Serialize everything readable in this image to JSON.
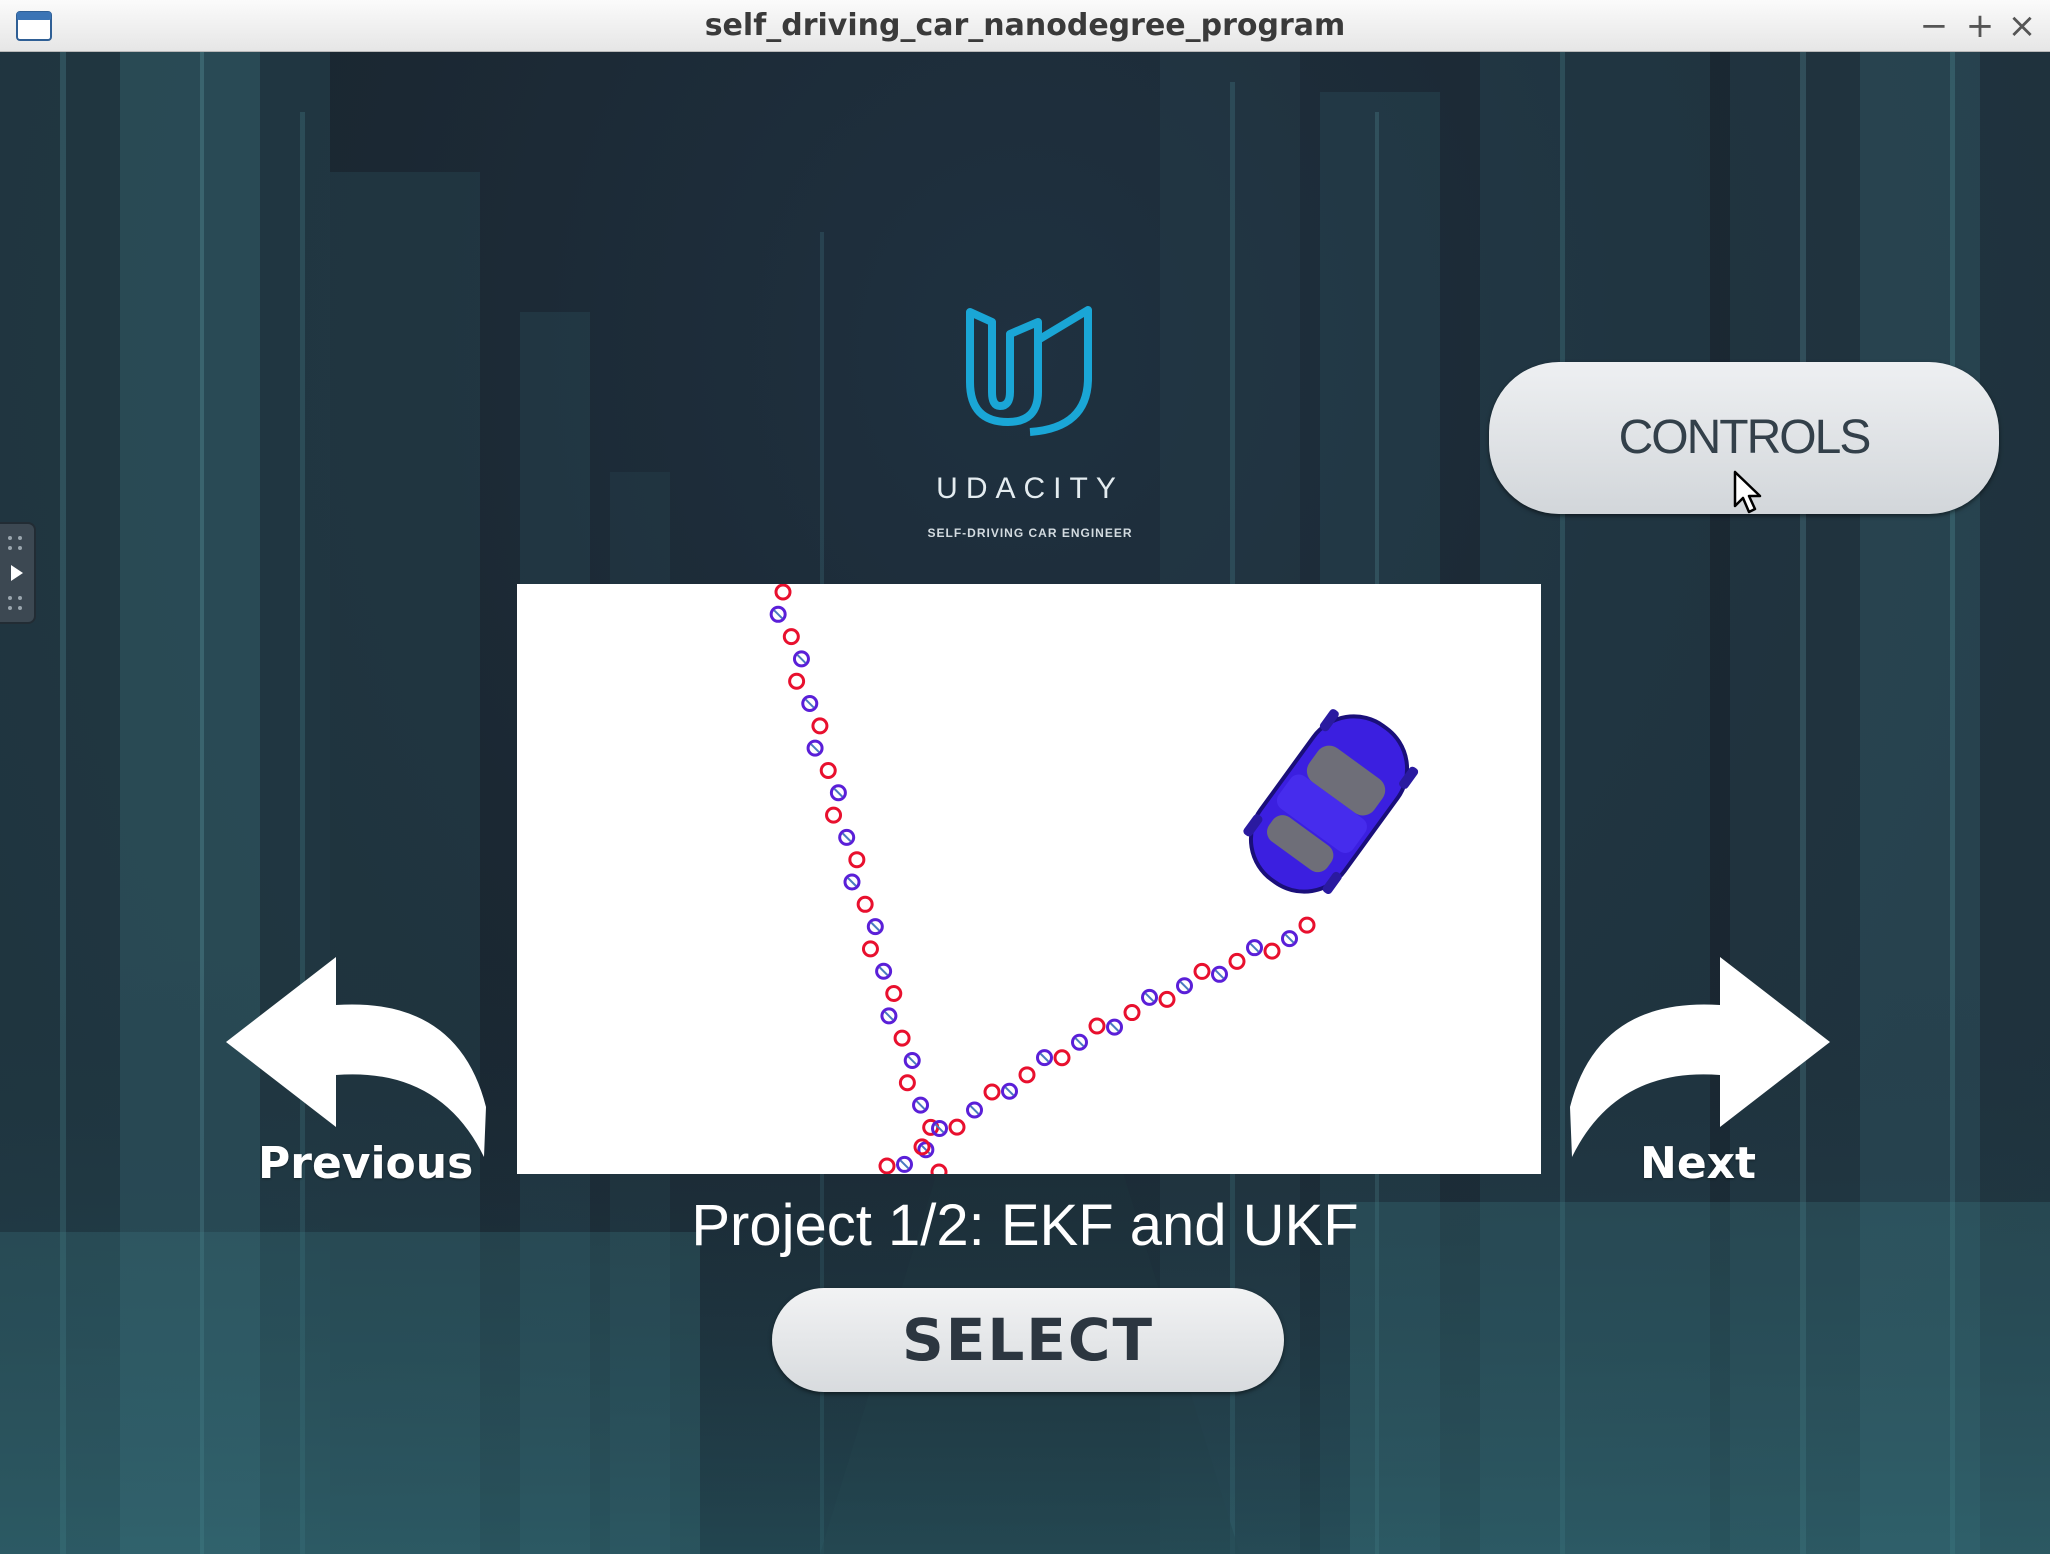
{
  "window": {
    "title": "self_driving_car_nanodegree_program",
    "minimize_glyph": "−",
    "maximize_glyph": "+",
    "close_glyph": "×",
    "app_icon": "window-icon"
  },
  "logo": {
    "icon": "udacity-u-logo",
    "wordmark": "UDACITY",
    "subtitle": "SELF-DRIVING CAR ENGINEER",
    "color": "#1aa6d6"
  },
  "controls_button": {
    "label": "CONTROLS"
  },
  "navigation": {
    "previous_label": "Previous",
    "next_label": "Next",
    "previous_icon": "arrow-left-icon",
    "next_icon": "arrow-right-icon"
  },
  "project": {
    "title": "Project 1/2: EKF and UKF",
    "select_label": "SELECT"
  },
  "preview": {
    "car_color": "#3b1fe0",
    "lidar_marker_color": "#e8102e",
    "radar_marker_color": "#5a1fd8"
  },
  "side_panel_handle": {
    "icon": "play-icon"
  },
  "cursor": {
    "icon": "mouse-pointer-icon"
  }
}
